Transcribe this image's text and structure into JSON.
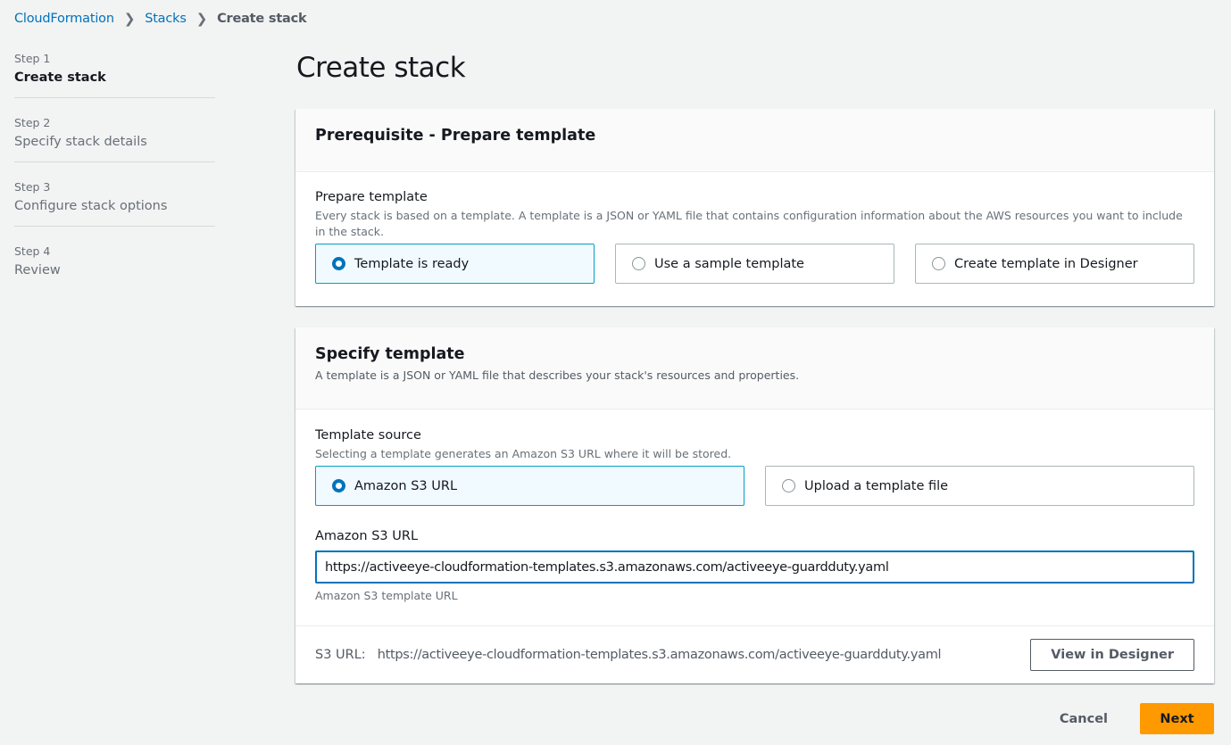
{
  "breadcrumb": {
    "items": [
      "CloudFormation",
      "Stacks"
    ],
    "current": "Create stack",
    "separator_icon": "chevron-right-icon"
  },
  "steps": [
    {
      "num": "Step 1",
      "title": "Create stack",
      "active": true
    },
    {
      "num": "Step 2",
      "title": "Specify stack details",
      "active": false
    },
    {
      "num": "Step 3",
      "title": "Configure stack options",
      "active": false
    },
    {
      "num": "Step 4",
      "title": "Review",
      "active": false
    }
  ],
  "page_title": "Create stack",
  "prerequisite": {
    "header": "Prerequisite - Prepare template",
    "field_label": "Prepare template",
    "field_desc": "Every stack is based on a template. A template is a JSON or YAML file that contains configuration information about the AWS resources you want to include in the stack.",
    "options": [
      {
        "label": "Template is ready",
        "selected": true
      },
      {
        "label": "Use a sample template",
        "selected": false
      },
      {
        "label": "Create template in Designer",
        "selected": false
      }
    ]
  },
  "specify": {
    "header": "Specify template",
    "header_desc": "A template is a JSON or YAML file that describes your stack's resources and properties.",
    "source_label": "Template source",
    "source_desc": "Selecting a template generates an Amazon S3 URL where it will be stored.",
    "options": [
      {
        "label": "Amazon S3 URL",
        "selected": true
      },
      {
        "label": "Upload a template file",
        "selected": false
      }
    ],
    "url_label": "Amazon S3 URL",
    "url_value": "https://activeeye-cloudformation-templates.s3.amazonaws.com/activeeye-guardduty.yaml",
    "url_hint": "Amazon S3 template URL",
    "footer_label": "S3 URL:",
    "footer_value": "https://activeeye-cloudformation-templates.s3.amazonaws.com/activeeye-guardduty.yaml",
    "view_designer": "View in Designer"
  },
  "actions": {
    "cancel": "Cancel",
    "next": "Next"
  },
  "colors": {
    "link": "#0073bb",
    "primary": "#ff9900",
    "selected_border": "#00a1c9",
    "selected_bg": "#f1faff"
  }
}
